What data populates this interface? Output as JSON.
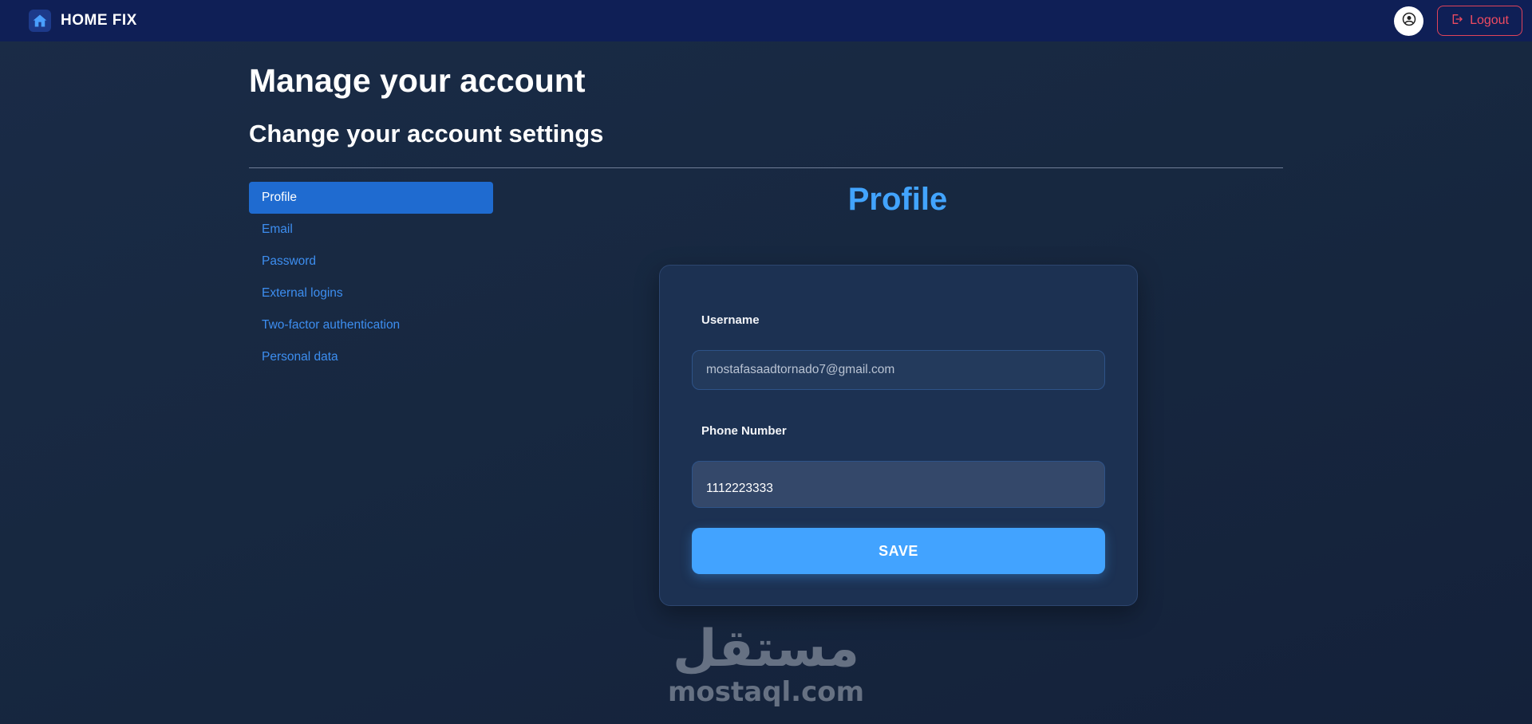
{
  "navbar": {
    "brand_name": "HOME FIX",
    "logout_label": "Logout"
  },
  "header": {
    "title": "Manage your account",
    "subtitle": "Change your account settings"
  },
  "sidenav": {
    "items": [
      {
        "label": "Profile",
        "active": true
      },
      {
        "label": "Email",
        "active": false
      },
      {
        "label": "Password",
        "active": false
      },
      {
        "label": "External logins",
        "active": false
      },
      {
        "label": "Two-factor authentication",
        "active": false
      },
      {
        "label": "Personal data",
        "active": false
      }
    ]
  },
  "profile": {
    "heading": "Profile",
    "username_label": "Username",
    "username_value": "mostafasaadtornado7@gmail.com",
    "phone_label": "Phone Number",
    "phone_value": "1112223333",
    "save_label": "SAVE"
  },
  "watermark": {
    "arabic": "مستقل",
    "latin": "mostaql.com"
  },
  "colors": {
    "navbar_bg": "#0f1f56",
    "accent": "#42a3ff",
    "active_nav": "#1f6bd0",
    "link": "#3d8ef0",
    "logout": "#ef4b61"
  },
  "icons": {
    "brand": "house-icon",
    "user": "user-circle-icon",
    "logout": "logout-icon"
  }
}
